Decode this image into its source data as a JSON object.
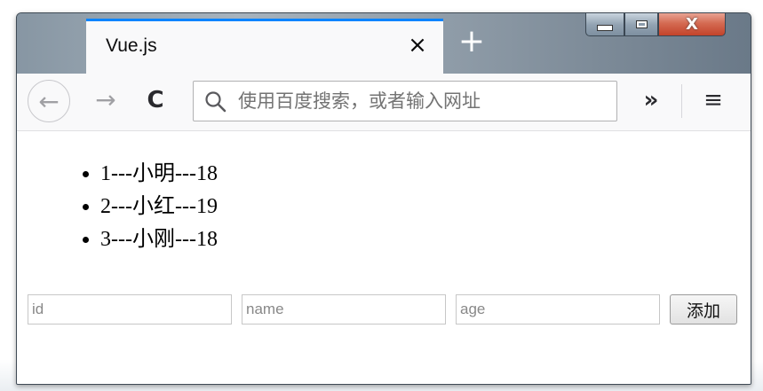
{
  "browser": {
    "tab": {
      "title": "Vue.js",
      "close_icon": "×"
    },
    "new_tab_icon": "+",
    "window_controls": {
      "close_icon": "X"
    },
    "nav": {
      "back_icon": "←",
      "forward_icon": "→",
      "reload_icon": "C",
      "url_placeholder": "使用百度搜索，或者输入网址",
      "overflow_icon": "»",
      "menu_icon": "≡"
    }
  },
  "page": {
    "users": [
      {
        "text": "1---小明---18"
      },
      {
        "text": "2---小红---19"
      },
      {
        "text": "3---小刚---18"
      }
    ],
    "form": {
      "id_placeholder": "id",
      "name_placeholder": "name",
      "age_placeholder": "age",
      "add_label": "添加"
    }
  }
}
